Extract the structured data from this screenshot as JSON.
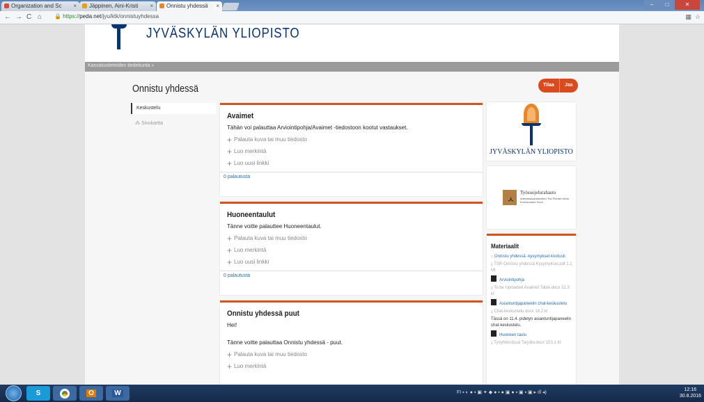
{
  "browser": {
    "tabs": [
      {
        "label": "Organization and Sc",
        "color": "#d64b3a"
      },
      {
        "label": "Jäppinen, Aini-Kristi",
        "color": "#e0a020"
      },
      {
        "label": "Onnistu yhdessä",
        "color": "#e8862a"
      }
    ],
    "close_glyph": "×",
    "url_scheme": "https://",
    "url_host": "peda.net",
    "url_path": "/jyu/ktk/onnistuyhdessa"
  },
  "header": {
    "university_name": "JYVÄSKYLÄN YLIOPISTO",
    "breadcrumb": "Kasvatustieteiden tiedekunta »"
  },
  "page": {
    "title": "Onnistu yhdessä",
    "order_button": "Tilaa",
    "share_button": "Jaa"
  },
  "sidenav": {
    "items": [
      {
        "label": "Keskustelu"
      },
      {
        "label": "Sivukartta"
      }
    ]
  },
  "cards": [
    {
      "title": "Avaimet",
      "text": "Tähän voi palauttaa Arviointipohja/Avaimet -tiedostoon kootut vastaukset.",
      "actions": [
        "Palauta kuva tai muu tiedosto",
        "Luo merkintä",
        "Luo uusi linkki"
      ],
      "footer": "0 palautusta"
    },
    {
      "title": "Huoneentaulut",
      "text": "Tänne voitte palauttee Huoneentaulut.",
      "actions": [
        "Palauta kuva tai muu tiedosto",
        "Luo merkintä",
        "Luo uusi linkki"
      ],
      "footer": "0 palautusta"
    },
    {
      "title": "Onnistu yhdessä puut",
      "text": "Hei!",
      "text2": "Tänne voitte palauttaa Onnistu yhdessä - puut.",
      "actions": [
        "Palauta kuva tai muu tiedosto",
        "Luo merkintä"
      ]
    }
  ],
  "logos": {
    "university": "JYVÄSKYLÄN YLIOPISTO",
    "fund": "Työsuojelurahasto",
    "fund_sub": "Arbetarskyddsfonden The Finnish Work Environment Fund"
  },
  "materials": {
    "title": "Materiaalit",
    "items": [
      {
        "kind": "link",
        "text": "Onnistu yhdessä -kysymykset kootusti"
      },
      {
        "kind": "meta",
        "text": "TSR-Onnistu yhdessä Kysymykset.pdf 1.1 Mt"
      },
      {
        "kind": "doclink",
        "text": "Arviointipohja"
      },
      {
        "kind": "meta",
        "text": "To be Uploaded Avaimet Table.docx 22.3 kt"
      },
      {
        "kind": "doclink",
        "text": "Asiantuntijapaneelin chat-keskustelu"
      },
      {
        "kind": "meta",
        "text": "Chat-keskustelu.docx 18.2 kt"
      },
      {
        "kind": "txt",
        "text": "Tässä on 11.4. pidetyn asiantuntijapaneelin chat-keskustelu."
      },
      {
        "kind": "doclink",
        "text": "Huoneen taulu"
      },
      {
        "kind": "meta",
        "text": "Työyhteisössä Tarjolla.docx 153.1 kt"
      }
    ]
  },
  "taskbar": {
    "apps": [
      {
        "label": "S",
        "color": "#1a9bd7"
      },
      {
        "label": "",
        "color": "#dd4b39"
      },
      {
        "label": "O",
        "color": "#e07b00"
      },
      {
        "label": "W",
        "color": "#2b579a"
      }
    ],
    "tray_lang": "FI",
    "time": "12:16",
    "date": "30.8.2016"
  }
}
